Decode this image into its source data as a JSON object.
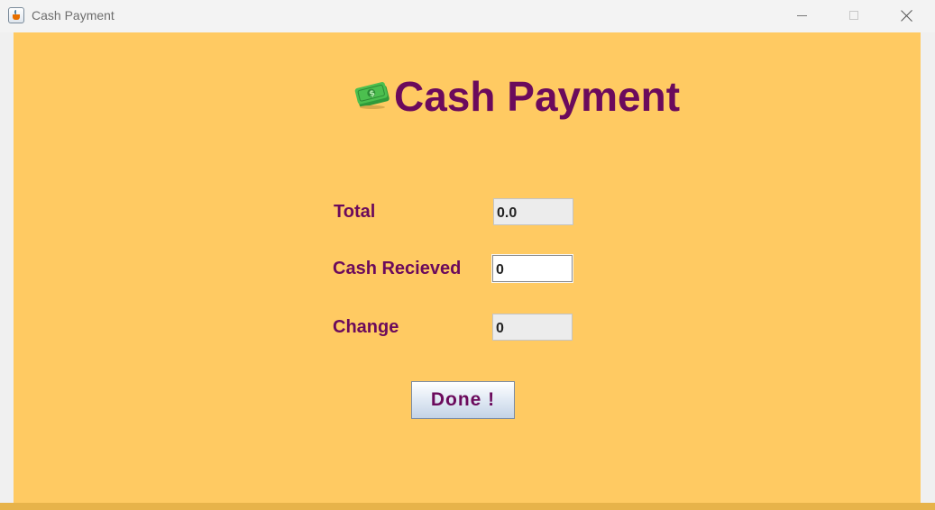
{
  "window": {
    "title": "Cash Payment",
    "app_icon": "java-icon",
    "controls": [
      "minimize-icon",
      "maximize-icon",
      "close-icon"
    ]
  },
  "colors": {
    "background": "#ffca62",
    "text": "#6b0a5c",
    "readonly_field": "#ececec",
    "editable_field": "#ffffff"
  },
  "header": {
    "icon": "money-icon",
    "title": "Cash Payment"
  },
  "form": {
    "total": {
      "label": "Total",
      "value": "0.0"
    },
    "cash_received": {
      "label": "Cash Recieved",
      "value": "0"
    },
    "change": {
      "label": "Change",
      "value": "0"
    }
  },
  "done_button": {
    "label": "Done !"
  }
}
